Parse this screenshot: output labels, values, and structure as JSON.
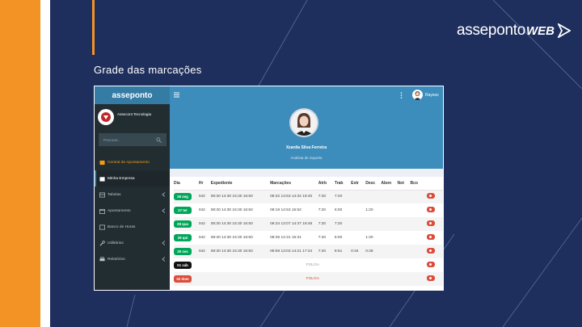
{
  "slide": {
    "title": "Grade das marcações",
    "brand_main": "asseponto",
    "brand_suffix": "WEB"
  },
  "app": {
    "logo": "asseponto",
    "company": "Assecont Tecnologia",
    "search_placeholder": "Procurar...",
    "menu": [
      {
        "label": "Central de Apontamento",
        "icon": "clock-icon",
        "state": "highlight"
      },
      {
        "label": "Minha Empresa",
        "icon": "building-icon",
        "state": "active"
      },
      {
        "label": "Tabelas",
        "icon": "table-icon",
        "state": "normal"
      },
      {
        "label": "Apontamento",
        "icon": "calendar-icon",
        "state": "normal"
      },
      {
        "label": "Banco de Horas",
        "icon": "bank-icon",
        "state": "normal"
      },
      {
        "label": "Utilitários",
        "icon": "wrench-icon",
        "state": "normal"
      },
      {
        "label": "Relatórios",
        "icon": "print-icon",
        "state": "normal"
      }
    ],
    "top_user": "Raysso",
    "profile_name": "Xzanila Silva Ferreira",
    "profile_role": "Analista de Suporte",
    "columns": [
      "Dia",
      "Hr",
      "Expediente",
      "Marcações",
      "Atrb",
      "Trab",
      "Extr",
      "Desc",
      "Abon",
      "Not",
      "Bco"
    ],
    "rows": [
      {
        "dia": "26 seg",
        "badge": "green",
        "hr": "042",
        "exp": "08:30 14:30 15:30 16:50",
        "marc": "08:32 13:53 14:34 18:40",
        "atrb": "7:20",
        "trab": "7:20",
        "extr": "",
        "desc": "",
        "abon": "",
        "not": "",
        "bco": "",
        "folga": ""
      },
      {
        "dia": "27 ter",
        "badge": "green",
        "hr": "042",
        "exp": "08:30 14:30 15:30 16:50",
        "marc": "08:19 14:53 15:52",
        "atrb": "7:20",
        "trab": "6:00",
        "extr": "",
        "desc": "1:20",
        "abon": "",
        "not": "",
        "bco": "",
        "folga": ""
      },
      {
        "dia": "28 qua",
        "badge": "green",
        "hr": "042",
        "exp": "08:30 14:30 15:30 16:50",
        "marc": "08:34 13:07 14:37 18:48",
        "atrb": "7:20",
        "trab": "7:20",
        "extr": "",
        "desc": "",
        "abon": "",
        "not": "",
        "bco": "",
        "folga": ""
      },
      {
        "dia": "29 qui",
        "badge": "green",
        "hr": "042",
        "exp": "08:30 14:30 15:30 16:50",
        "marc": "08:35 14:31 15:31",
        "atrb": "7:20",
        "trab": "6:00",
        "extr": "",
        "desc": "1:20",
        "abon": "",
        "not": "",
        "bco": "",
        "folga": ""
      },
      {
        "dia": "30 sex",
        "badge": "green",
        "hr": "042",
        "exp": "08:30 14:30 15:30 16:50",
        "marc": "08:59 13:03 14:21 17:24",
        "atrb": "7:20",
        "trab": "8:51",
        "extr": "0:34",
        "desc": "0:28",
        "abon": "",
        "not": "",
        "bco": "",
        "folga": ""
      },
      {
        "dia": "01 sáb",
        "badge": "black",
        "hr": "",
        "exp": "",
        "marc": "",
        "atrb": "",
        "trab": "",
        "extr": "",
        "desc": "",
        "abon": "",
        "not": "",
        "bco": "",
        "folga": "FOLGA"
      },
      {
        "dia": "02 dom",
        "badge": "red",
        "hr": "",
        "exp": "",
        "marc": "",
        "atrb": "",
        "trab": "",
        "extr": "",
        "desc": "",
        "abon": "",
        "not": "",
        "bco": "",
        "folga": "FOLGA"
      }
    ]
  },
  "colors": {
    "orange": "#f39325",
    "navy": "#1f2f5d",
    "sidebar": "#222d32",
    "header_blue": "#3c8dbc",
    "green": "#00a65a",
    "red": "#dd4b39"
  }
}
